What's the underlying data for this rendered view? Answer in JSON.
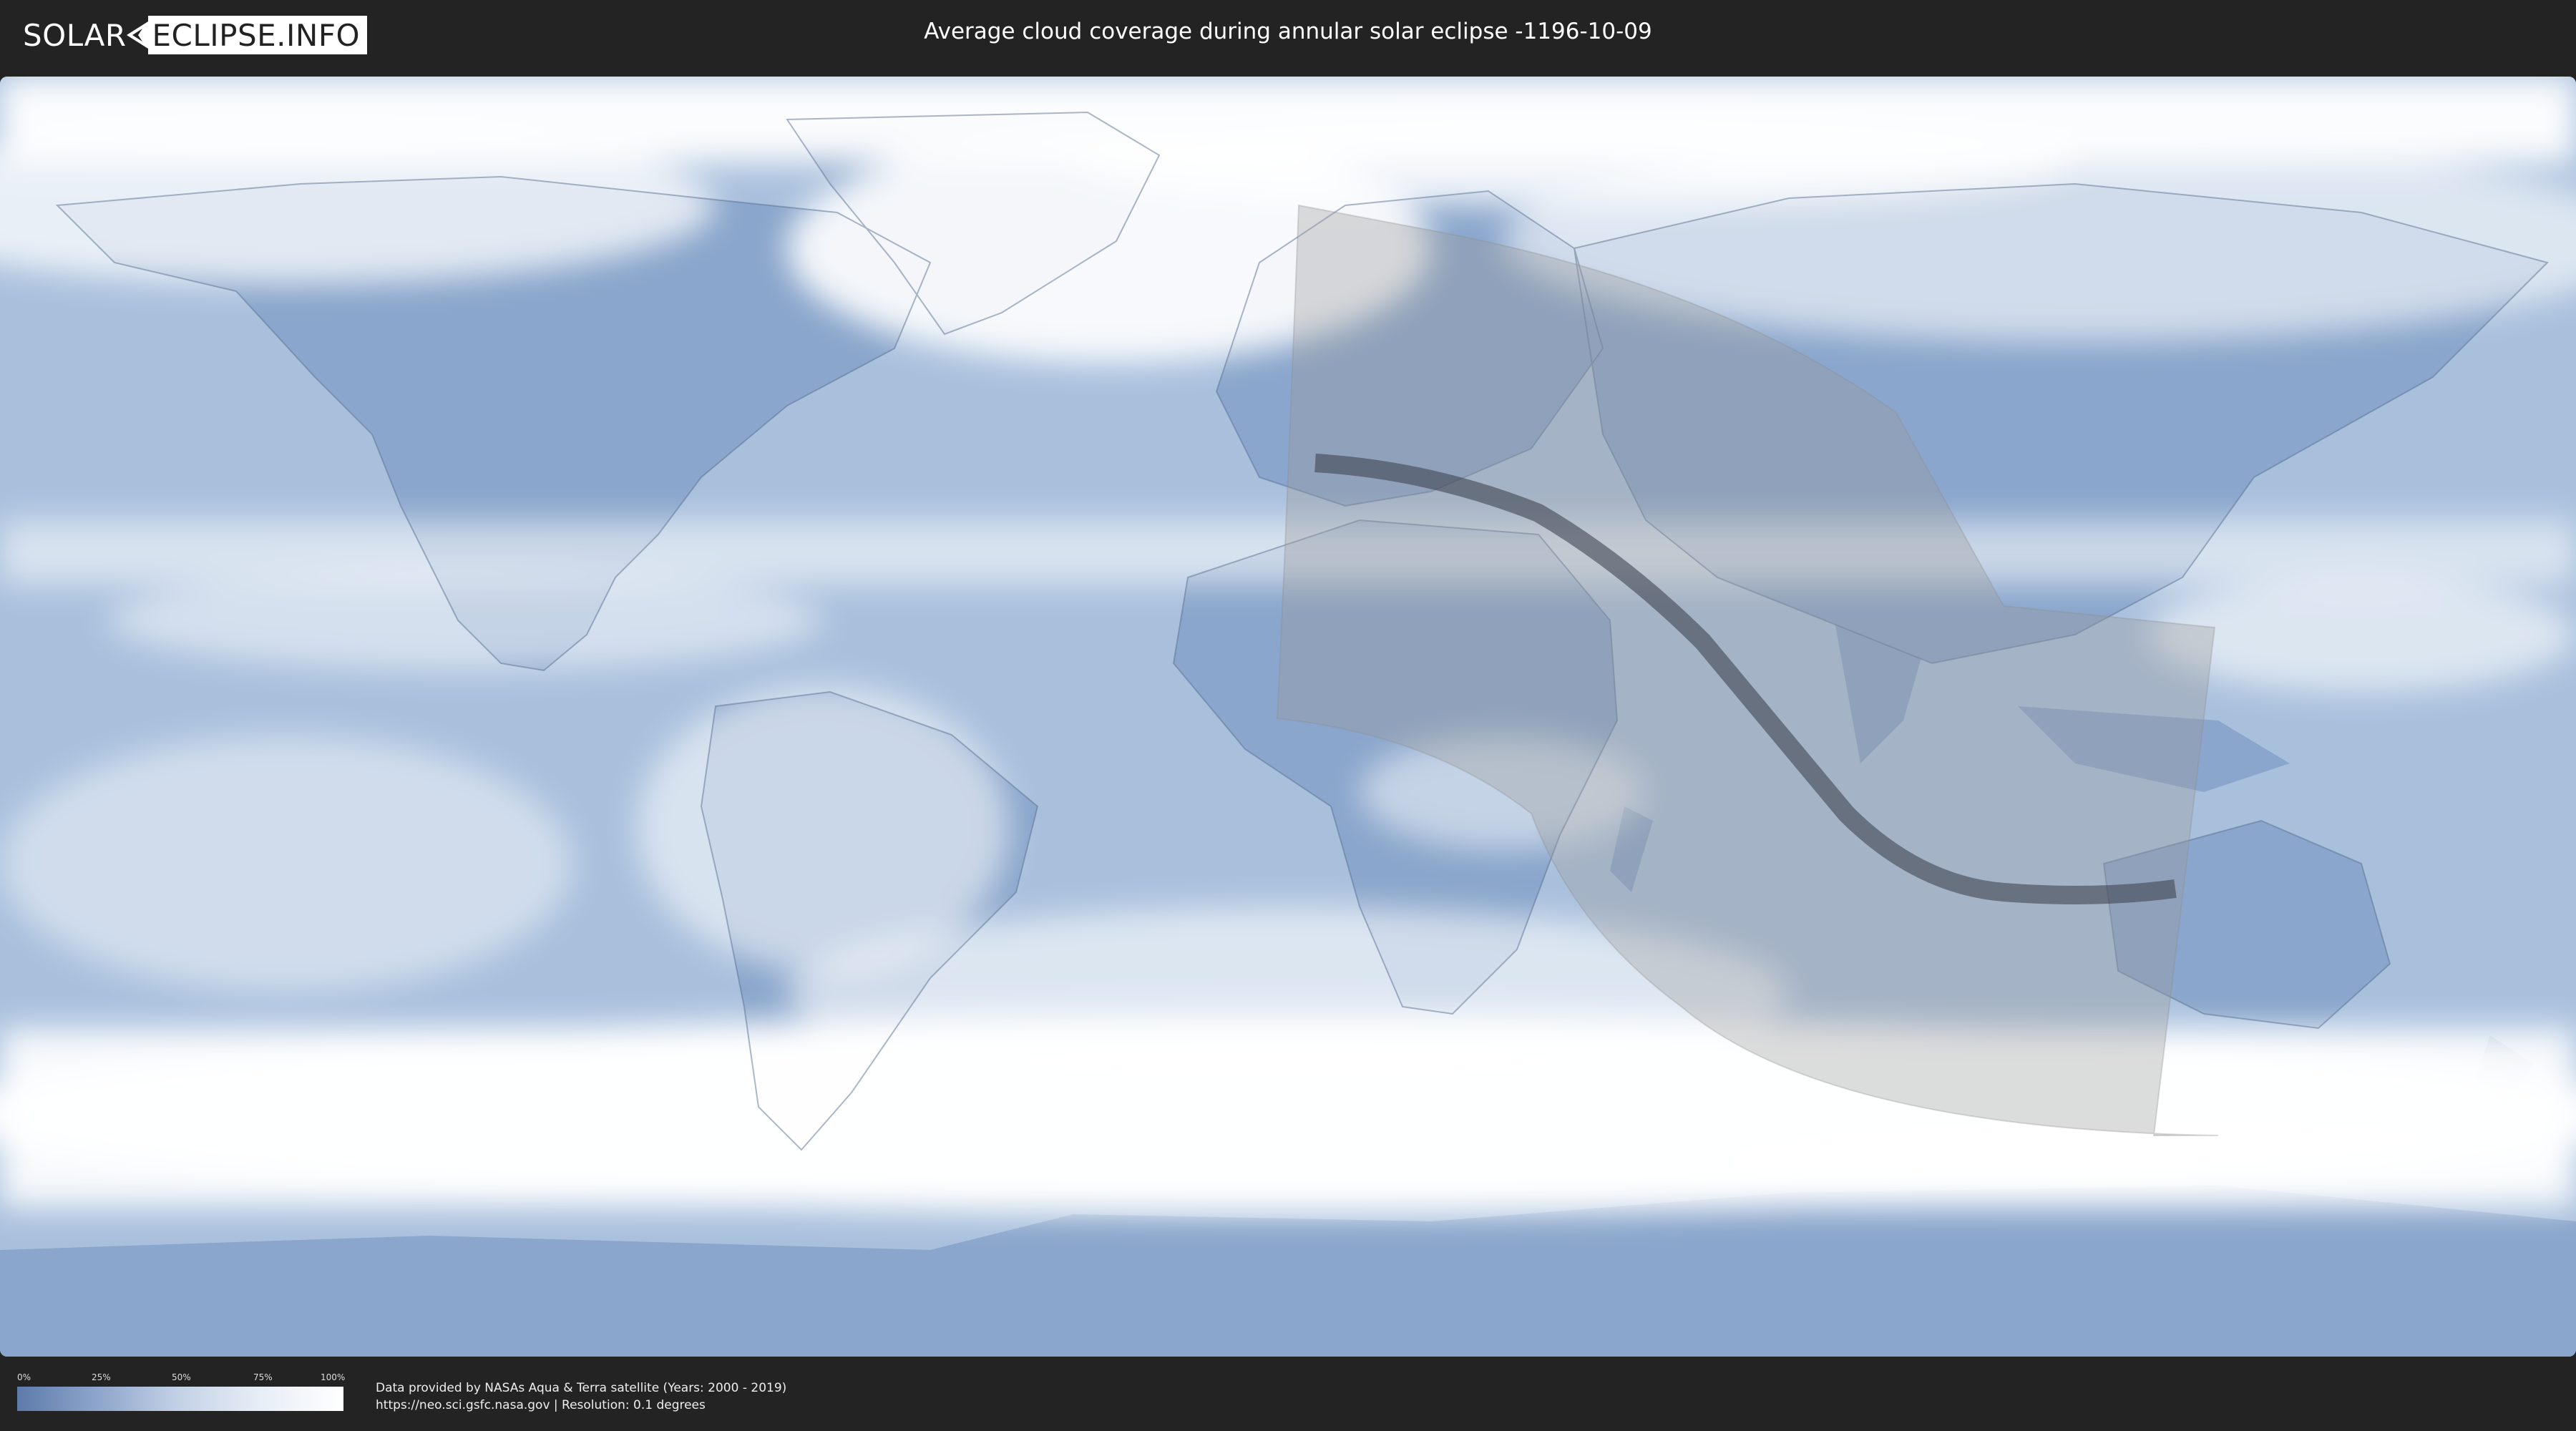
{
  "header": {
    "logo_part1": "SOLAR",
    "logo_part2": "ECLIPSE.INFO",
    "title": "Average cloud coverage during annular solar eclipse -1196-10-09"
  },
  "legend": {
    "ticks": [
      "0%",
      "25%",
      "50%",
      "75%",
      "100%"
    ],
    "colors": [
      "#5d7bab",
      "#8ea6cb",
      "#c4d2e6",
      "#e8eef6",
      "#ffffff"
    ]
  },
  "footer": {
    "source_line1": "Data provided by NASAs Aqua & Terra satellite (Years: 2000 - 2019)",
    "source_line2": "https://neo.sci.gsfc.nasa.gov | Resolution: 0.1 degrees"
  },
  "map": {
    "projection": "equirectangular",
    "ocean_color": "#a9c0dd",
    "land_color": "#7f9cc6",
    "cloud_color": "#ffffff",
    "penumbra_color": "#bdbdbd",
    "central_line_color": "#404552"
  }
}
